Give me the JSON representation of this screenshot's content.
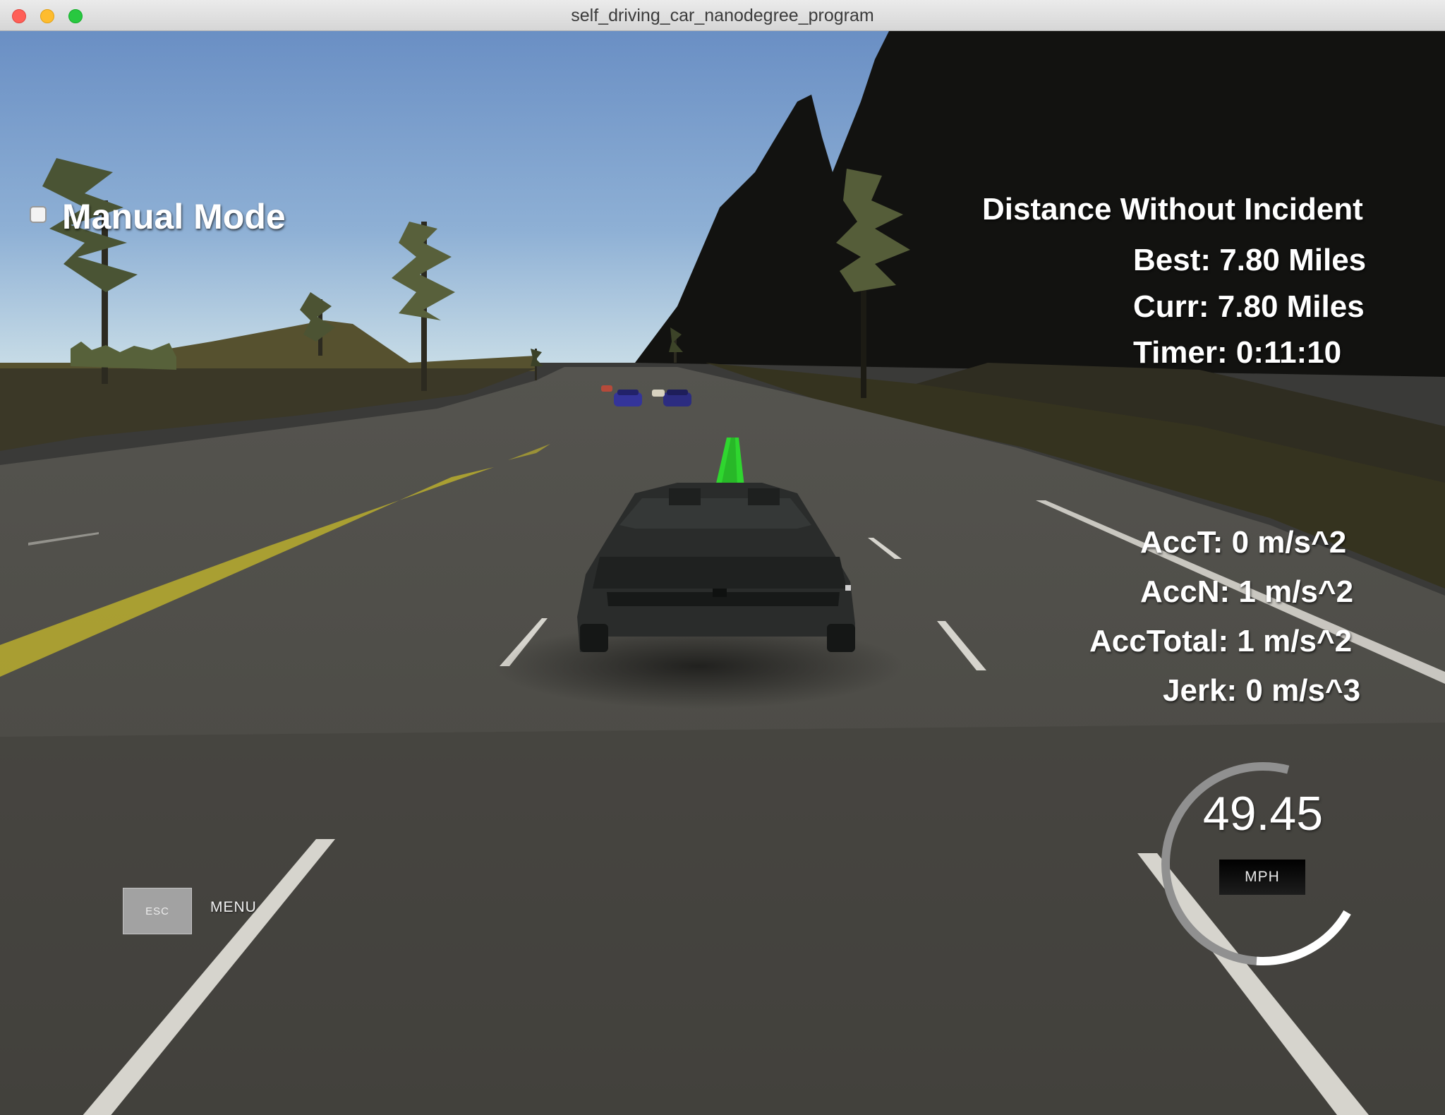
{
  "window": {
    "title": "self_driving_car_nanodegree_program"
  },
  "colors": {
    "sky_top": "#6f94c7",
    "sky_horizon": "#bdd3e3",
    "road": "#4a4946",
    "center_line": "#b9ad2e",
    "lane_marking": "#d6d4cd",
    "waypoints": "#2fd62f",
    "gauge_track": "#909090",
    "gauge_fill": "#ffffff"
  },
  "hud": {
    "manual_mode": {
      "label": "Manual Mode",
      "checked": false
    },
    "distance": {
      "heading": "Distance Without Incident",
      "best": "Best: 7.80 Miles",
      "curr": "Curr: 7.80 Miles",
      "timer": "Timer: 0:11:10"
    },
    "accel": {
      "acc_t": "AccT: 0 m/s^2",
      "acc_n": "AccN: 1 m/s^2",
      "acc_total": "AccTotal: 1 m/s^2",
      "jerk": "Jerk: 0 m/s^3"
    },
    "speedometer": {
      "value": "49.45",
      "unit": "MPH",
      "needle_fraction": 0.25
    },
    "menu": {
      "key_label": "ESC",
      "label": "MENU"
    }
  }
}
